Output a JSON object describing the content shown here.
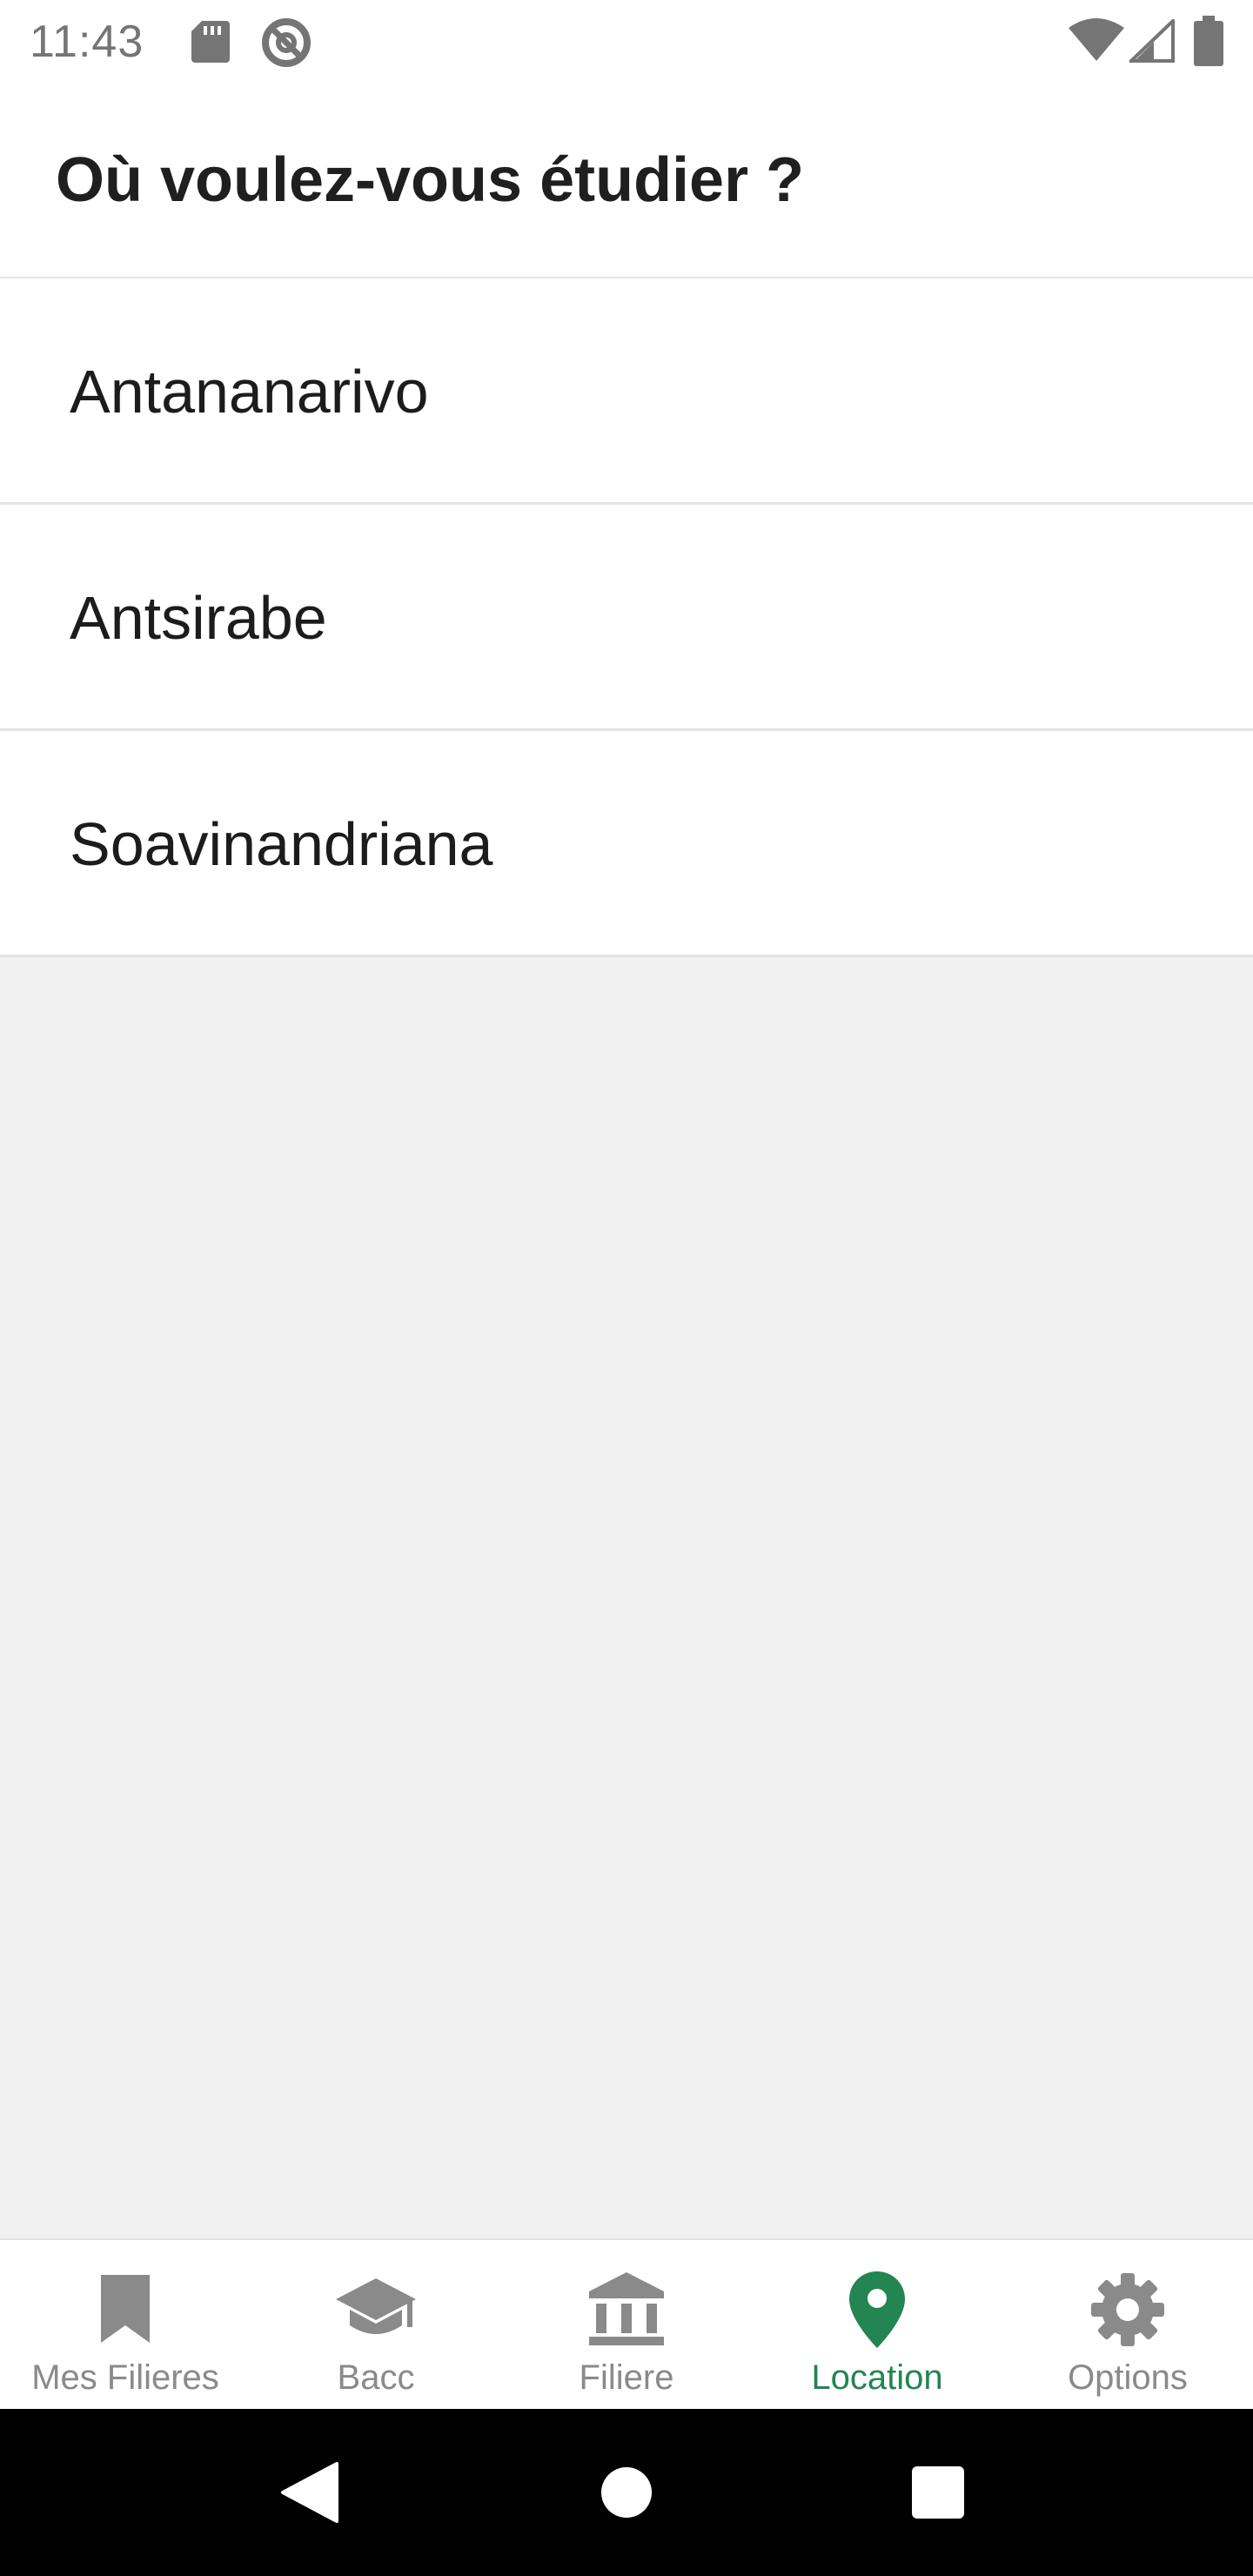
{
  "status_bar": {
    "time": "11:43",
    "icons": [
      "sd-card-icon",
      "no-tracking-icon",
      "wifi-icon",
      "cellular-signal-icon",
      "battery-icon"
    ]
  },
  "header": {
    "title": "Où voulez-vous étudier ?"
  },
  "locations": [
    {
      "label": "Antananarivo"
    },
    {
      "label": "Antsirabe"
    },
    {
      "label": "Soavinandriana"
    }
  ],
  "bottom_nav": {
    "active": "Location",
    "items": [
      {
        "label": "Mes Filieres",
        "icon": "bookmark-icon"
      },
      {
        "label": "Bacc",
        "icon": "graduation-cap-icon"
      },
      {
        "label": "Filiere",
        "icon": "institution-icon"
      },
      {
        "label": "Location",
        "icon": "location-pin-icon"
      },
      {
        "label": "Options",
        "icon": "gear-icon"
      }
    ]
  },
  "system_nav": {
    "icons": [
      "back-icon",
      "home-icon",
      "recents-icon"
    ]
  },
  "colors": {
    "accent": "#238552",
    "inactive": "#8a8a8a",
    "list_background": "#f1f1f1"
  }
}
